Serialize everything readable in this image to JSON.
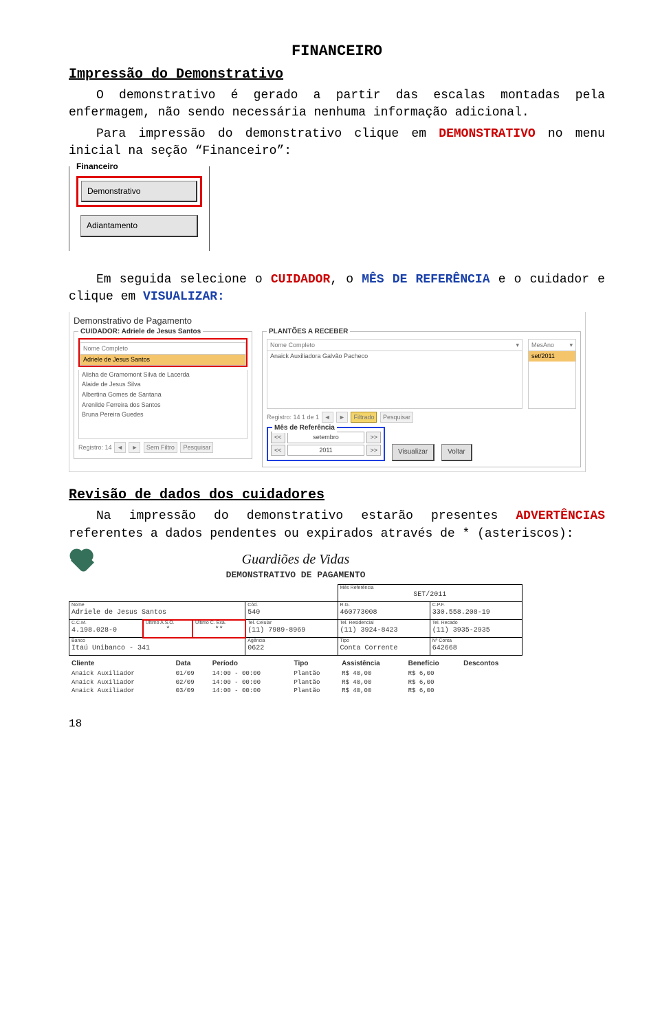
{
  "title": "FINANCEIRO",
  "h1": "Impressão do Demonstrativo",
  "p1a": "O demonstrativo é gerado a partir das escalas montadas pela enfermagem, não sendo necessária nenhuma informação adicional.",
  "p1b_a": "Para impressão do demonstrativo clique em ",
  "p1b_hl": "DEMONSTRATIVO",
  "p1b_b": " no menu inicial na seção “Financeiro”:",
  "shot1": {
    "legend": "Financeiro",
    "btn_demo": "Demonstrativo",
    "btn_adi": "Adiantamento"
  },
  "p2_a": "Em seguida selecione o ",
  "p2_hl1": "CUIDADOR",
  "p2_b": ", o ",
  "p2_hl2": "MÊS DE REFERÊNCIA",
  "p2_c": " e o cuidador e clique em ",
  "p2_hl3": "VISUALIZAR:",
  "shot2": {
    "title": "Demonstrativo de Pagamento",
    "left_legend": "CUIDADOR: Adriele de Jesus Santos",
    "left_header": "Nome Completo",
    "left_rows": {
      "r0": "Adriele de Jesus Santos",
      "r1": "Alisha de Gramomont Silva de Lacerda",
      "r2": "Alaide de Jesus Silva",
      "r3": "Albertina Gomes de Santana",
      "r4": "Arenilde Ferreira dos Santos",
      "r5": "Bruna Pereira Guedes"
    },
    "left_nav": "Registro: 14",
    "left_nav_filter": "Sem Filtro",
    "left_nav_search": "Pesquisar",
    "right_legend": "PLANTÕES A RECEBER",
    "right_col1": "Nome Completo",
    "right_col2": "MesAno",
    "right_row1_a": "Anaick Auxiliadora Galvão Pacheco",
    "right_row1_b": "set/2011",
    "right_nav_rec": "Registro: 14 1 de 1",
    "right_nav_filter": "Filtrado",
    "right_nav_search": "Pesquisar",
    "mes_legend": "Mês de Referência",
    "mes_month": "setembro",
    "mes_year": "2011",
    "arrow_left": "<<",
    "arrow_right": ">>",
    "btn_vis": "Visualizar",
    "btn_vol": "Voltar"
  },
  "h2": "Revisão de dados dos cuidadores",
  "p3_a": "Na impressão do demonstrativo estarão presentes ",
  "p3_hl": "ADVERTÊNCIAS",
  "p3_b": " referentes a dados pendentes ou expirados através de * (asteriscos):",
  "shot3": {
    "brand": "Guardiões de Vidas",
    "reptitle": "DEMONSTRATIVO DE PAGAMENTO",
    "lbl_ref": "Mês Referência",
    "val_ref": "SET/2011",
    "lbl_nome": "Nome",
    "val_nome": "Adriele de Jesus Santos",
    "lbl_cod": "Cód.",
    "val_cod": "540",
    "lbl_rg": "R.G.",
    "val_rg": "460773008",
    "lbl_cpf": "C.P.F.",
    "val_cpf": "330.558.208-19",
    "lbl_ccm": "C.C.M.",
    "val_ccm": "4.198.028-0",
    "lbl_aso": "Último A.S.O.",
    "val_aso": "*",
    "lbl_exa": "Último C. Exa.",
    "val_exa": "**",
    "lbl_cel": "Tel. Celular",
    "val_cel": "(11) 7989-8969",
    "lbl_res": "Tel. Residencial",
    "val_res": "(11) 3924-8423",
    "lbl_rec": "Tel. Recado",
    "val_rec": "(11) 3935-2935",
    "lbl_banco": "Banco",
    "val_banco": "Itaú Unibanco - 341",
    "lbl_ag": "Agência",
    "val_ag": "0622",
    "lbl_tipo": "Tipo",
    "val_tipo": "Conta Corrente",
    "lbl_conta": "Nº Conta",
    "val_conta": "642668",
    "th": {
      "c1": "Cliente",
      "c2": "Data",
      "c3": "Período",
      "c4": "Tipo",
      "c5": "Assistência",
      "c6": "Benefício",
      "c7": "Descontos"
    },
    "rows": {
      "r1": {
        "c1": "Anaick Auxiliador",
        "c2": "01/09",
        "c3": "14:00 - 00:00",
        "c4": "Plantão",
        "c5": "R$ 40,00",
        "c6": "R$ 6,00",
        "c7": ""
      },
      "r2": {
        "c1": "Anaick Auxiliador",
        "c2": "02/09",
        "c3": "14:00 - 00:00",
        "c4": "Plantão",
        "c5": "R$ 40,00",
        "c6": "R$ 6,00",
        "c7": ""
      },
      "r3": {
        "c1": "Anaick Auxiliador",
        "c2": "03/09",
        "c3": "14:00 - 00:00",
        "c4": "Plantão",
        "c5": "R$ 40,00",
        "c6": "R$ 6,00",
        "c7": ""
      }
    }
  },
  "page_number": "18"
}
